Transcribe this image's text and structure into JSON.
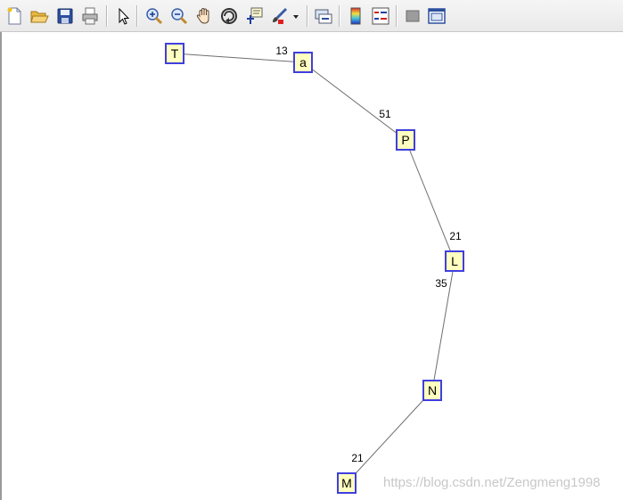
{
  "toolbar": {
    "buttons": [
      {
        "name": "new-figure-button",
        "icon": "new-document-icon"
      },
      {
        "name": "open-file-button",
        "icon": "folder-open-icon"
      },
      {
        "name": "save-figure-button",
        "icon": "save-disk-icon"
      },
      {
        "name": "print-figure-button",
        "icon": "printer-icon"
      },
      {
        "name": "edit-plot-button",
        "icon": "arrow-pointer-icon"
      },
      {
        "name": "zoom-in-button",
        "icon": "zoom-in-icon"
      },
      {
        "name": "zoom-out-button",
        "icon": "zoom-out-icon"
      },
      {
        "name": "pan-button",
        "icon": "hand-pan-icon"
      },
      {
        "name": "rotate-3d-button",
        "icon": "rotate-3d-icon"
      },
      {
        "name": "data-cursor-button",
        "icon": "data-cursor-icon"
      },
      {
        "name": "brush-button",
        "icon": "brush-icon"
      },
      {
        "name": "brush-dropdown-button",
        "icon": "chevron-down-icon"
      },
      {
        "name": "link-plot-button",
        "icon": "link-plot-icon"
      },
      {
        "name": "insert-colorbar-button",
        "icon": "colorbar-icon"
      },
      {
        "name": "insert-legend-button",
        "icon": "legend-icon"
      },
      {
        "name": "hide-plot-tools-button",
        "icon": "hide-tools-icon"
      },
      {
        "name": "show-plot-tools-button",
        "icon": "show-tools-icon"
      }
    ]
  },
  "graph": {
    "nodes": [
      {
        "id": "T",
        "label": "T"
      },
      {
        "id": "a",
        "label": "a"
      },
      {
        "id": "P",
        "label": "P"
      },
      {
        "id": "L",
        "label": "L"
      },
      {
        "id": "N",
        "label": "N"
      },
      {
        "id": "M",
        "label": "M"
      }
    ],
    "edges": [
      {
        "from": "T",
        "to": "a",
        "weight": "13"
      },
      {
        "from": "a",
        "to": "P",
        "weight": "51"
      },
      {
        "from": "P",
        "to": "L",
        "weight": "21"
      },
      {
        "from": "L",
        "to": "N",
        "weight": "35"
      },
      {
        "from": "N",
        "to": "M",
        "weight": "21"
      }
    ],
    "colors": {
      "node_fill": "#ffffc0",
      "node_border": "#3f3fdf",
      "edge": "#6e6e6e",
      "label_text": "#000000"
    }
  },
  "watermark": "https://blog.csdn.net/Zengmeng1998"
}
